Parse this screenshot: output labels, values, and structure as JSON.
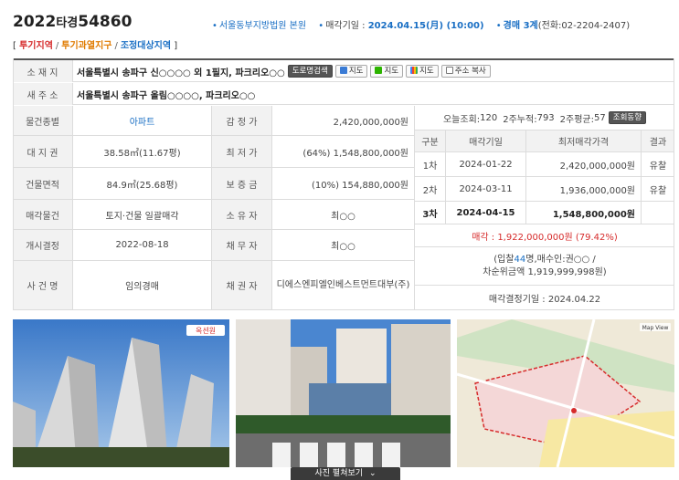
{
  "header": {
    "case_year": "2022",
    "case_type": "타경",
    "case_number": "54860",
    "court": "서울동부지방법원 본원",
    "sale_date_label": "매각기일 : ",
    "sale_date": "2024.04.15(月) (10:00)",
    "dept_label": "경매 ",
    "dept": "3계",
    "phone": "(전화:02-2204-2407)"
  },
  "tags": [
    "투기지역",
    "투기과열지구",
    "조정대상지역"
  ],
  "tags_brackets": [
    "[",
    "]"
  ],
  "tags_sep": "/",
  "address": {
    "label": "소 재 지",
    "value": "서울특별시 송파구 신○○○○ 외 1필지, 파크리오○○",
    "buttons": [
      "도로명검색",
      "지도",
      "지도",
      "지도",
      "주소 복사"
    ]
  },
  "new_address": {
    "label": "새 주 소",
    "value": "서울특별시 송파구 올림○○○○, 파크리오○○"
  },
  "details": [
    {
      "label": "물건종별",
      "value": "아파트",
      "label2": "감 정 가",
      "value2": "2,420,000,000원"
    },
    {
      "label": "대 지 권",
      "value": "38.58㎡(11.67평)",
      "label2": "최 저 가",
      "value2": "(64%) 1,548,800,000원"
    },
    {
      "label": "건물면적",
      "value": "84.9㎡(25.68평)",
      "label2": "보 증 금",
      "value2": "(10%) 154,880,000원"
    },
    {
      "label": "매각물건",
      "value": "토지·건물 일괄매각",
      "label2": "소 유 자",
      "value2": "최○○"
    },
    {
      "label": "개시결정",
      "value": "2022-08-18",
      "label2": "채 무 자",
      "value2": "최○○"
    },
    {
      "label": "사 건 명",
      "value": "임의경매",
      "label2": "채 권 자",
      "value2": "디에스엔피엘인베스트먼트대부(주)"
    }
  ],
  "views": {
    "today_label": "오늘조회: ",
    "today": "120",
    "week2_label": "2주누적: ",
    "week2": "793",
    "avg_label": "2주평균: ",
    "avg": "57",
    "btn": "조회동향"
  },
  "rounds": {
    "headers": [
      "구분",
      "매각기일",
      "최저매각가격",
      "결과"
    ],
    "rows": [
      {
        "round": "1차",
        "date": "2024-01-22",
        "price": "2,420,000,000원",
        "result": "유찰"
      },
      {
        "round": "2차",
        "date": "2024-03-11",
        "price": "1,936,000,000원",
        "result": "유찰"
      },
      {
        "round": "3차",
        "date": "2024-04-15",
        "price": "1,548,800,000원",
        "result": ""
      }
    ],
    "sold": "매각 : 1,922,000,000원 (79.42%)",
    "bid_line1_a": "(입찰",
    "bid_count": "44",
    "bid_line1_b": "명,매수인:권○○ /",
    "bid_line2": "차순위금액 1,919,999,998원)",
    "decision": "매각결정기일 : 2024.04.22"
  },
  "photos": {
    "more_button": "사진 펼쳐보기",
    "logo": "옥션원",
    "map_label": "Map View"
  },
  "colors": {
    "accent": "#1a6fc4",
    "red": "#d62b2b",
    "orange": "#e07b00"
  }
}
